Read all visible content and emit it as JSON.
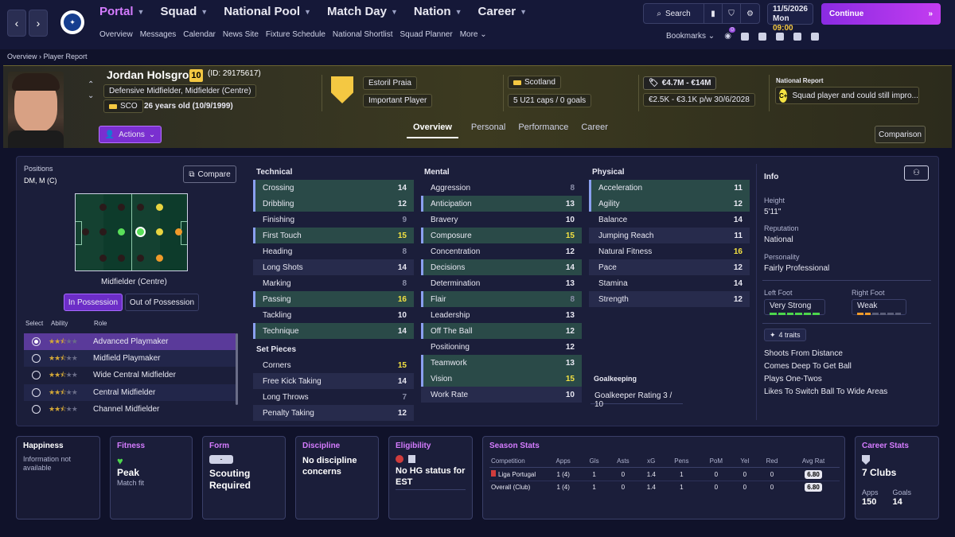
{
  "nav": {
    "main": [
      {
        "label": "Portal",
        "active": true
      },
      {
        "label": "Squad",
        "active": false
      },
      {
        "label": "National Pool",
        "active": false
      },
      {
        "label": "Match Day",
        "active": false
      },
      {
        "label": "Nation",
        "active": false
      },
      {
        "label": "Career",
        "active": false
      }
    ],
    "sub": [
      "Overview",
      "Messages",
      "Calendar",
      "News Site",
      "Fixture Schedule",
      "National Shortlist",
      "Squad Planner",
      "More"
    ],
    "search_label": "Search",
    "date": "11/5/2026",
    "day_time_day": "Mon",
    "day_time_time": "09:00",
    "continue_label": "Continue",
    "bookmarks_label": "Bookmarks",
    "notif_count": "0"
  },
  "breadcrumb": {
    "a": "Overview",
    "b": "Player Report"
  },
  "player": {
    "name": "Jordan Holsgrove",
    "number": "10",
    "id": "(ID: 29175617)",
    "positions": "Defensive Midfielder, Midfielder (Centre)",
    "nation_code": "SCO",
    "age": "26 years old (10/9/1999)",
    "club": "Estoril Praia",
    "club_status": "Important Player",
    "nation": "Scotland",
    "caps": "5 U21 caps / 0 goals",
    "value": "€4.7M - €14M",
    "wage": "€2.5K - €3.1K p/w 30/6/2028",
    "report_label": "National Report",
    "report_grade": "C+",
    "report_text": "Squad player and could still impro..."
  },
  "header_tabs": [
    "Overview",
    "Personal",
    "Performance",
    "Career"
  ],
  "actions_label": "Actions",
  "comparison_label": "Comparison",
  "positions_panel": {
    "title": "Positions",
    "codes": "DM, M (C)",
    "compare_label": "Compare",
    "pitch_label": "Midfielder (Centre)",
    "in_possession": "In Possession",
    "out_possession": "Out of Possession",
    "headers": [
      "Select",
      "Ability",
      "Role"
    ],
    "roles": [
      {
        "name": "Advanced Playmaker",
        "stars": 2.5,
        "selected": true
      },
      {
        "name": "Midfield Playmaker",
        "stars": 2.5,
        "selected": false
      },
      {
        "name": "Wide Central Midfielder",
        "stars": 2.5,
        "selected": false
      },
      {
        "name": "Central Midfielder",
        "stars": 2.5,
        "selected": false
      },
      {
        "name": "Channel Midfielder",
        "stars": 2.5,
        "selected": false
      }
    ]
  },
  "attributes": {
    "technical_title": "Technical",
    "technical": [
      {
        "name": "Crossing",
        "value": "14",
        "hl": true
      },
      {
        "name": "Dribbling",
        "value": "12",
        "hl": true
      },
      {
        "name": "Finishing",
        "value": "9",
        "hl": false
      },
      {
        "name": "First Touch",
        "value": "15",
        "hl": true
      },
      {
        "name": "Heading",
        "value": "8",
        "hl": false
      },
      {
        "name": "Long Shots",
        "value": "14",
        "hl": false
      },
      {
        "name": "Marking",
        "value": "8",
        "hl": false
      },
      {
        "name": "Passing",
        "value": "16",
        "hl": true
      },
      {
        "name": "Tackling",
        "value": "10",
        "hl": false
      },
      {
        "name": "Technique",
        "value": "14",
        "hl": true
      }
    ],
    "setpieces_title": "Set Pieces",
    "setpieces": [
      {
        "name": "Corners",
        "value": "15",
        "hl": false
      },
      {
        "name": "Free Kick Taking",
        "value": "14",
        "hl": false
      },
      {
        "name": "Long Throws",
        "value": "7",
        "hl": false
      },
      {
        "name": "Penalty Taking",
        "value": "12",
        "hl": false
      }
    ],
    "mental_title": "Mental",
    "mental": [
      {
        "name": "Aggression",
        "value": "8",
        "hl": false
      },
      {
        "name": "Anticipation",
        "value": "13",
        "hl": true
      },
      {
        "name": "Bravery",
        "value": "10",
        "hl": false
      },
      {
        "name": "Composure",
        "value": "15",
        "hl": true
      },
      {
        "name": "Concentration",
        "value": "12",
        "hl": false
      },
      {
        "name": "Decisions",
        "value": "14",
        "hl": true
      },
      {
        "name": "Determination",
        "value": "13",
        "hl": false
      },
      {
        "name": "Flair",
        "value": "8",
        "hl": true
      },
      {
        "name": "Leadership",
        "value": "13",
        "hl": false
      },
      {
        "name": "Off The Ball",
        "value": "12",
        "hl": true
      },
      {
        "name": "Positioning",
        "value": "12",
        "hl": false
      },
      {
        "name": "Teamwork",
        "value": "13",
        "hl": true
      },
      {
        "name": "Vision",
        "value": "15",
        "hl": true
      },
      {
        "name": "Work Rate",
        "value": "10",
        "hl": false
      }
    ],
    "physical_title": "Physical",
    "physical": [
      {
        "name": "Acceleration",
        "value": "11",
        "hl": true
      },
      {
        "name": "Agility",
        "value": "12",
        "hl": true
      },
      {
        "name": "Balance",
        "value": "14",
        "hl": false
      },
      {
        "name": "Jumping Reach",
        "value": "11",
        "hl": false
      },
      {
        "name": "Natural Fitness",
        "value": "16",
        "hl": false
      },
      {
        "name": "Pace",
        "value": "12",
        "hl": false
      },
      {
        "name": "Stamina",
        "value": "14",
        "hl": false
      },
      {
        "name": "Strength",
        "value": "12",
        "hl": false
      }
    ],
    "gk_title": "Goalkeeping",
    "gk_label": "Goalkeeper Rating",
    "gk_value": "3 / 10"
  },
  "info": {
    "title": "Info",
    "height_label": "Height",
    "height": "5'11\"",
    "reputation_label": "Reputation",
    "reputation": "National",
    "personality_label": "Personality",
    "personality": "Fairly Professional",
    "left_foot_label": "Left Foot",
    "left_foot": "Very Strong",
    "right_foot_label": "Right Foot",
    "right_foot": "Weak",
    "traits_label": "4 traits",
    "traits": [
      "Shoots From Distance",
      "Comes Deep To Get Ball",
      "Plays One-Twos",
      "Likes To Switch Ball To Wide Areas"
    ]
  },
  "cards": {
    "happiness_title": "Happiness",
    "happiness_text": "Information not available",
    "fitness_title": "Fitness",
    "fitness_value": "Peak",
    "fitness_sub": "Match fit",
    "form_title": "Form",
    "form_badge": "-",
    "form_value": "Scouting Required",
    "discipline_title": "Discipline",
    "discipline_value": "No discipline concerns",
    "eligibility_title": "Eligibility",
    "eligibility_value": "No HG status for EST",
    "season_title": "Season Stats",
    "season_headers": [
      "Competition",
      "Apps",
      "Gls",
      "Asts",
      "xG",
      "Pens",
      "PoM",
      "Yel",
      "Red",
      "Avg Rat"
    ],
    "season_rows": [
      [
        "Liga Portugal",
        "1 (4)",
        "1",
        "0",
        "1.4",
        "1",
        "0",
        "0",
        "0",
        "6.80"
      ],
      [
        "Overall (Club)",
        "1 (4)",
        "1",
        "0",
        "1.4",
        "1",
        "0",
        "0",
        "0",
        "6.80"
      ]
    ],
    "career_title": "Career Stats",
    "career_clubs": "7 Clubs",
    "apps_label": "Apps",
    "apps": "150",
    "goals_label": "Goals",
    "goals": "14"
  }
}
